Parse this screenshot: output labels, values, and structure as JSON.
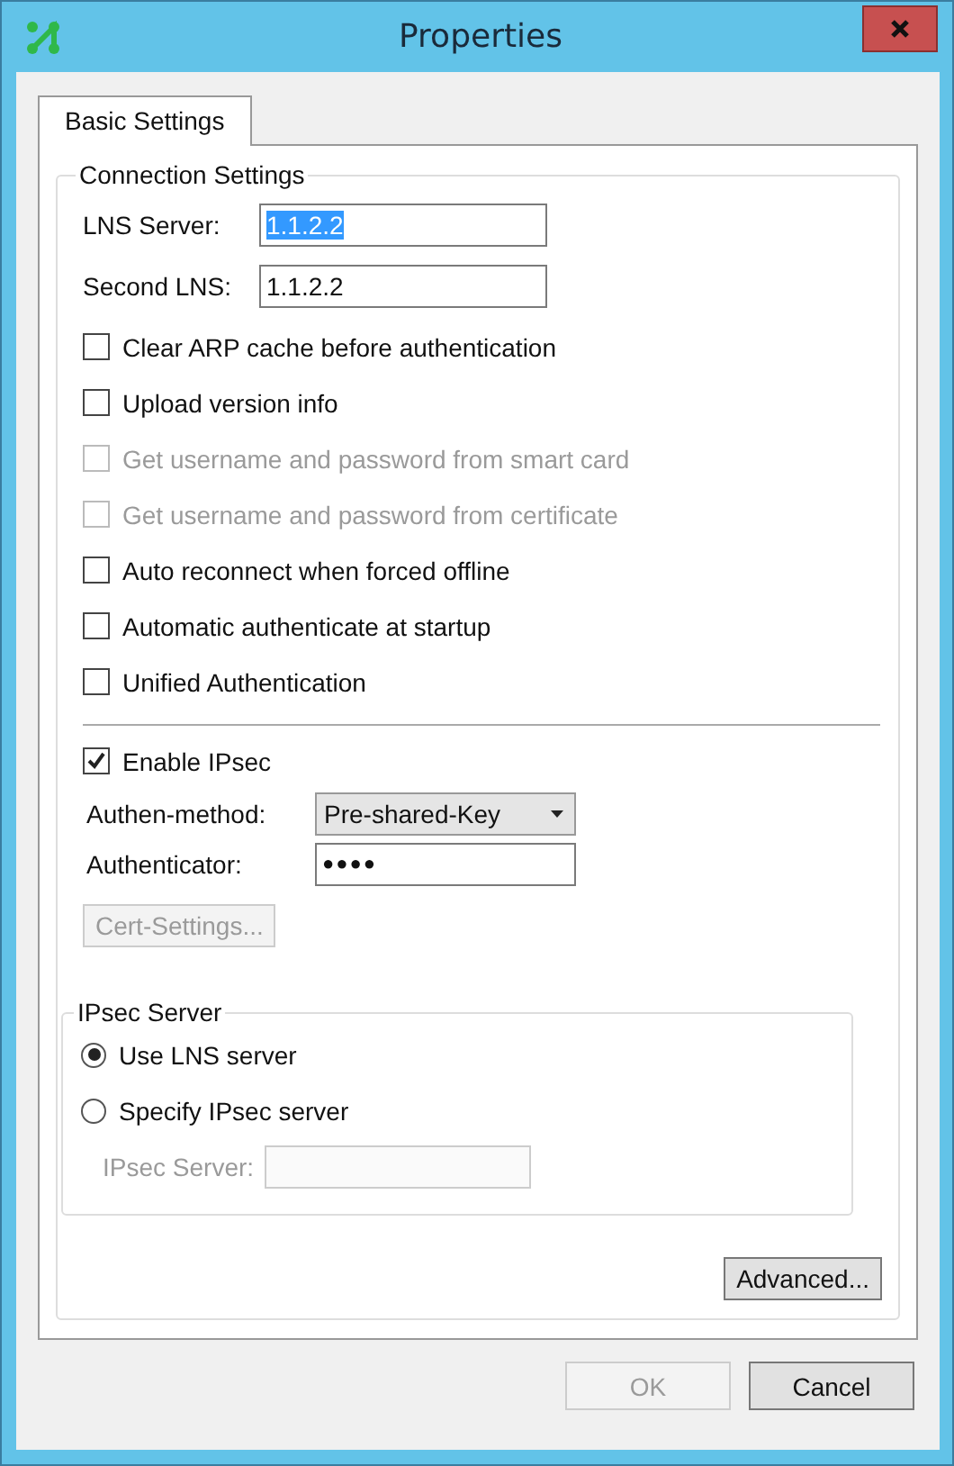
{
  "window": {
    "title": "Properties"
  },
  "tabs": [
    {
      "label": "Basic Settings",
      "selected": true
    }
  ],
  "connection_settings": {
    "title": "Connection Settings",
    "fields": [
      {
        "label": "LNS Server:",
        "value": "1.1.2.2",
        "text_selected": true
      },
      {
        "label": "Second LNS:",
        "value": "1.1.2.2",
        "text_selected": false
      }
    ],
    "checkboxes": [
      {
        "label": "Clear ARP cache before authentication",
        "checked": false,
        "disabled": false
      },
      {
        "label": "Upload version info",
        "checked": false,
        "disabled": false
      },
      {
        "label": "Get username and password from smart card",
        "checked": false,
        "disabled": true
      },
      {
        "label": "Get username and password from certificate",
        "checked": false,
        "disabled": true
      },
      {
        "label": "Auto reconnect when forced offline",
        "checked": false,
        "disabled": false
      },
      {
        "label": "Automatic authenticate at startup",
        "checked": false,
        "disabled": false
      },
      {
        "label": "Unified Authentication",
        "checked": false,
        "disabled": false
      }
    ],
    "enable_ipsec": {
      "label": "Enable IPsec",
      "checked": true,
      "disabled": false
    },
    "authen_method": {
      "label": "Authen-method:",
      "value": "Pre-shared-Key"
    },
    "authenticator": {
      "label": "Authenticator:",
      "value": "●●●●"
    },
    "cert_settings_button": {
      "label": "Cert-Settings...",
      "disabled": true
    },
    "ipsec_server": {
      "title": "IPsec Server",
      "radios": [
        {
          "label": "Use LNS server",
          "selected": true
        },
        {
          "label": "Specify IPsec server",
          "selected": false
        }
      ],
      "field": {
        "label": "IPsec Server:",
        "disabled": true
      }
    },
    "advanced_button": {
      "label": "Advanced...",
      "disabled": false
    }
  },
  "buttons": [
    {
      "label": "OK",
      "disabled": true
    },
    {
      "label": "Cancel",
      "disabled": false
    }
  ]
}
